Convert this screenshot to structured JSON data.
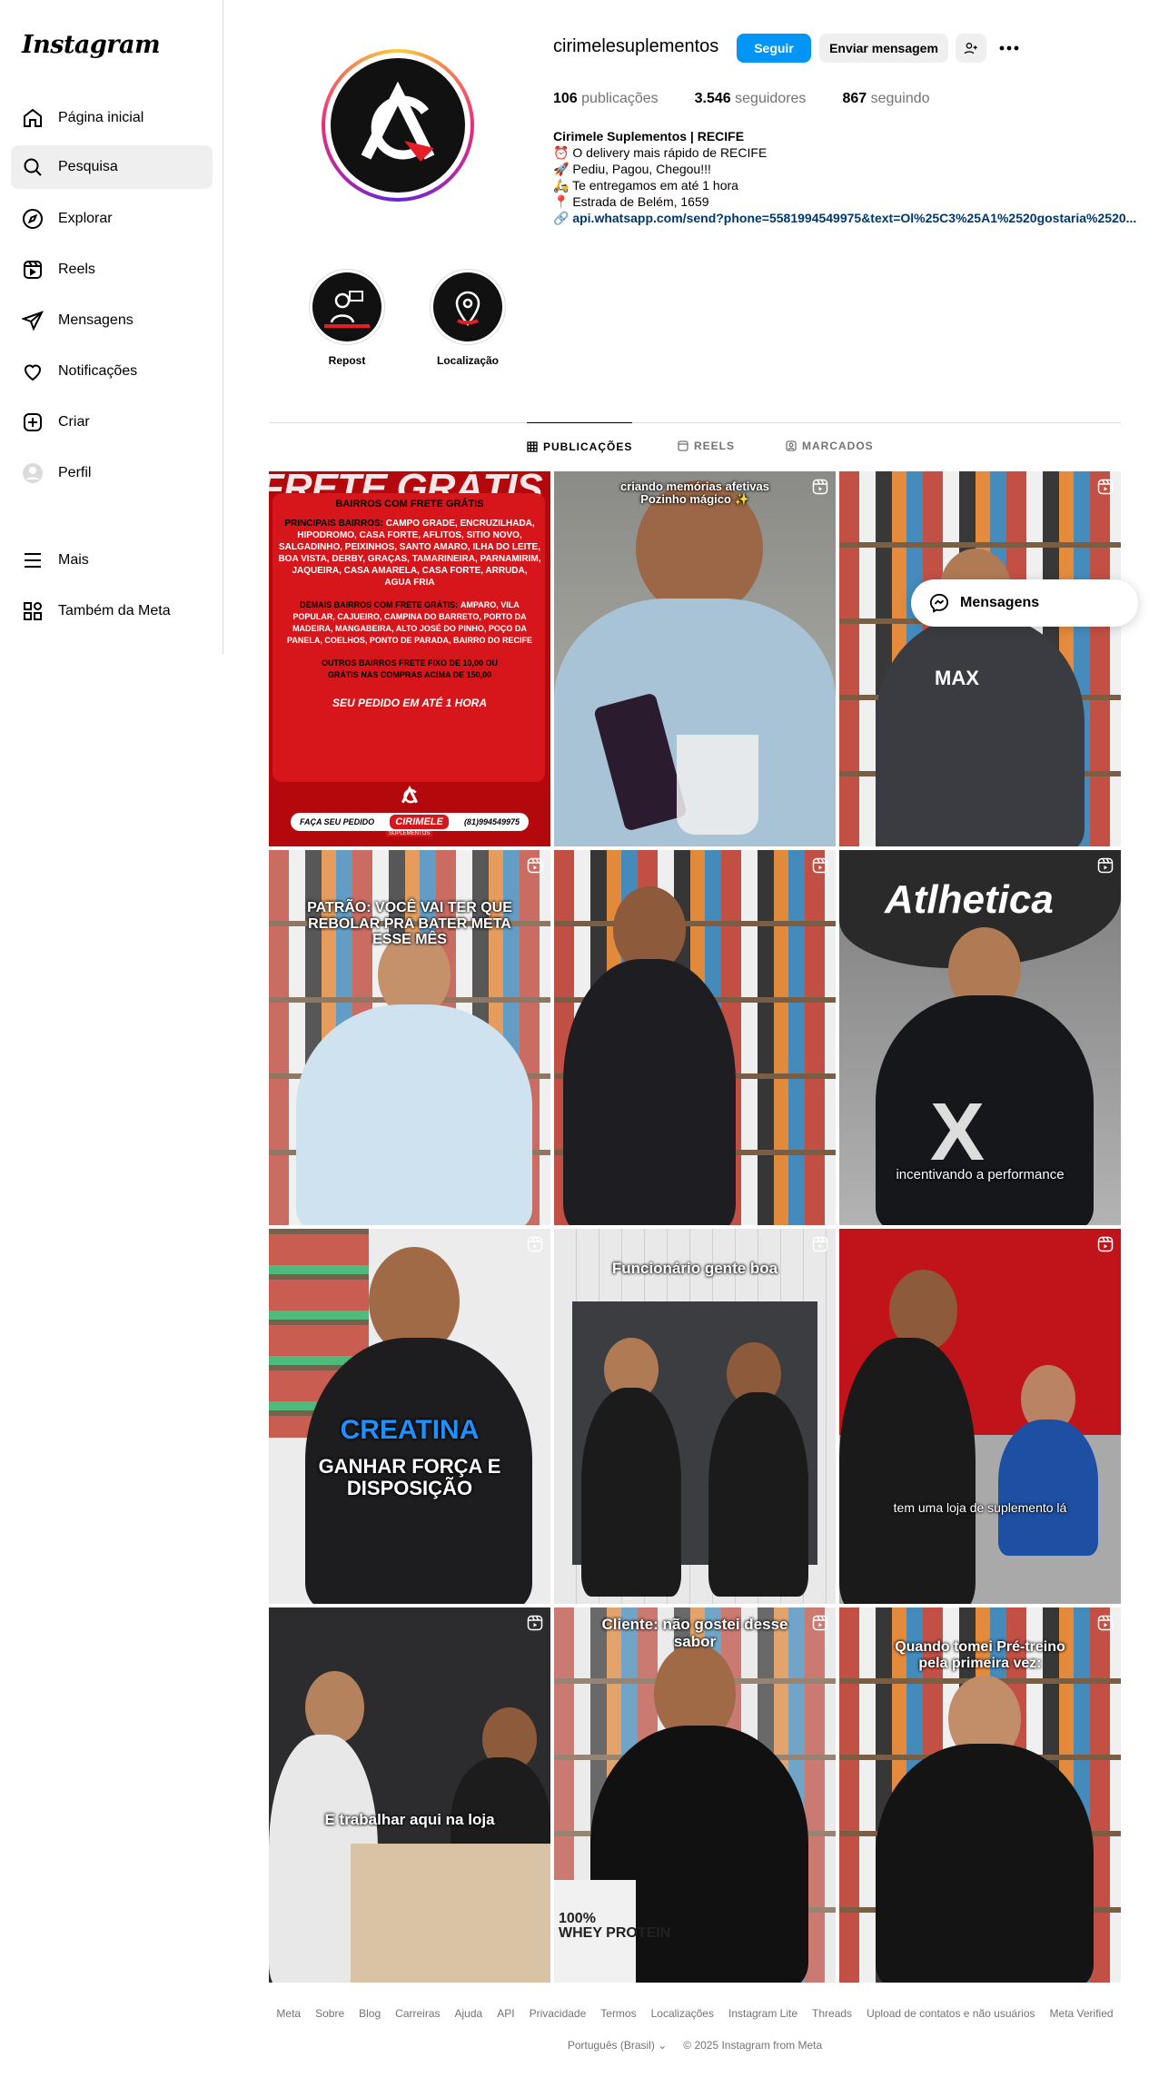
{
  "app": {
    "logo": "Instagram"
  },
  "sidebar": {
    "items": [
      {
        "label": "Página inicial",
        "icon": "home-icon"
      },
      {
        "label": "Pesquisa",
        "icon": "search-icon"
      },
      {
        "label": "Explorar",
        "icon": "explore-icon"
      },
      {
        "label": "Reels",
        "icon": "reels-icon"
      },
      {
        "label": "Mensagens",
        "icon": "messages-icon"
      },
      {
        "label": "Notificações",
        "icon": "heart-icon"
      },
      {
        "label": "Criar",
        "icon": "create-icon"
      },
      {
        "label": "Perfil",
        "icon": "profile-icon"
      }
    ],
    "more": "Mais",
    "meta": "Também da Meta",
    "active": "Pesquisa"
  },
  "profile": {
    "username": "cirimelesuplementos",
    "follow_label": "Seguir",
    "message_label": "Enviar mensagem",
    "stats": {
      "posts_count": "106",
      "posts_label": "publicações",
      "followers_count": "3.546",
      "followers_label": "seguidores",
      "following_count": "867",
      "following_label": "seguindo"
    },
    "bio": {
      "name": "Cirimele Suplementos | RECIFE",
      "line1": "⏰ O delivery mais rápido de RECIFE",
      "line2": "🚀 Pediu, Pagou, Chegou!!!",
      "line3": "🛵 Te entregamos em até 1 hora",
      "line4": "📍 Estrada de Belém, 1659",
      "link": "api.whatsapp.com/send?phone=5581994549975&text=Ol%25C3%25A1%2520gostaria%2520..."
    }
  },
  "highlights": [
    {
      "label": "Repost",
      "icon": "repost-icon"
    },
    {
      "label": "Localização",
      "icon": "location-icon"
    }
  ],
  "tabs": {
    "posts": "PUBLICAÇÕES",
    "reels": "REELS",
    "tagged": "MARCADOS"
  },
  "posts": {
    "p1": {
      "header": "BAIRROS COM FRETE GRÁTIS",
      "title_bg": "FRETE GRÁTIS",
      "main_title": "PRINCIPAIS BAIRROS:",
      "main_list": "CAMPO GRADE, ENCRUZILHADA, HIPODROMO, CASA FORTE, AFLITOS, SITIO NOVO, SALGADINHO, PEIXINHOS, SANTO AMARO, ILHA DO LEITE, BOA VISTA, DERBY, GRAÇAS, TAMARINEIRA, PARNAMIRIM, JAQUEIRA, CASA AMARELA, CASA FORTE, ARRUDA, AGUA FRIA",
      "others_title": "DEMAIS BAIRROS COM FRETE GRÁTIS:",
      "others_list": "AMPARO, VILA POPULAR, CAJUEIRO, CAMPINA DO BARRETO, PORTO DA MADEIRA, MANGABEIRA, ALTO JOSÉ DO PINHO, POÇO DA PANELA, COELHOS, PONTO DE PARADA, BAIRRO DO RECIFE",
      "fixed": "OUTROS BAIRROS FRETE FIXO DE 10,00 OU GRÁTIS NAS COMPRAS ACIMA DE 150,00",
      "delivery": "SEU PEDIDO EM ATÉ 1 HORA",
      "cta": "FAÇA SEU PEDIDO",
      "brand": "CIRIMELE",
      "brand_sub": "SUPLEMENTOS",
      "phone": "(81)994549975"
    },
    "p2": {
      "caption": "criando memórias afetivas\nPozinho mágico ✨"
    },
    "p4": {
      "caption": "PATRÃO: VOCÊ VAI TER QUE REBOLAR PRA BATER META ESSE MÊS"
    },
    "p6": {
      "brand": "Atlhetica",
      "caption": "incentivando a performance"
    },
    "p7": {
      "caption1": "CREATINA",
      "caption2": "GANHAR FORÇA E DISPOSIÇÃO"
    },
    "p8": {
      "caption": "Funcionário gente boa"
    },
    "p9": {
      "caption": "tem uma loja de suplemento lá"
    },
    "p10": {
      "caption": "E trabalhar aqui na loja"
    },
    "p11": {
      "caption": "Cliente: não gostei desse sabor"
    },
    "p12": {
      "caption": "Quando tomei Pré-treino pela primeira vez:"
    }
  },
  "floating": {
    "messages_label": "Mensagens"
  },
  "footer": {
    "links": [
      "Meta",
      "Sobre",
      "Blog",
      "Carreiras",
      "Ajuda",
      "API",
      "Privacidade",
      "Termos",
      "Localizações",
      "Instagram Lite",
      "Threads",
      "Upload de contatos e não usuários",
      "Meta Verified"
    ],
    "language": "Português (Brasil)",
    "copyright": "© 2025 Instagram from Meta"
  },
  "colors": {
    "accent": "#0095f6",
    "link": "#00376b",
    "muted": "#737373",
    "border": "#dbdbdb"
  }
}
